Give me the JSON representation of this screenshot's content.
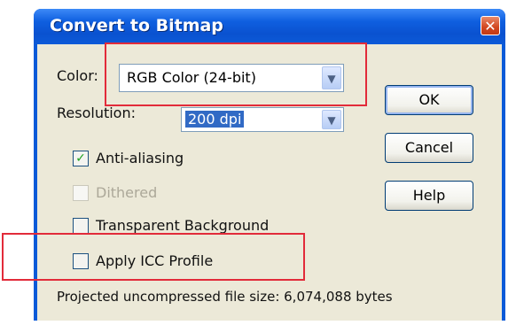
{
  "window": {
    "title": "Convert to Bitmap",
    "close_label": "✕"
  },
  "color": {
    "label": "Color:",
    "value": "RGB Color (24-bit)"
  },
  "resolution": {
    "label": "Resolution:",
    "value": "200 dpi"
  },
  "options": {
    "anti_aliasing": {
      "label": "Anti-aliasing",
      "checked": true
    },
    "dithered": {
      "label": "Dithered",
      "checked": false,
      "disabled": true
    },
    "transparent_background": {
      "label": "Transparent Background",
      "checked": false
    },
    "apply_icc_profile": {
      "label": "Apply ICC Profile",
      "checked": false
    }
  },
  "buttons": {
    "ok": "OK",
    "cancel": "Cancel",
    "help": "Help"
  },
  "status": "Projected uncompressed file size: 6,074,088 bytes",
  "colors": {
    "title_bar": "#0a52d0",
    "dialog_bg": "#ece9d8",
    "highlight": "#e22b3a",
    "check_mark": "#21a121"
  },
  "icons": {
    "dropdown": "chevron-down-icon",
    "check": "check-icon",
    "close": "close-icon"
  }
}
